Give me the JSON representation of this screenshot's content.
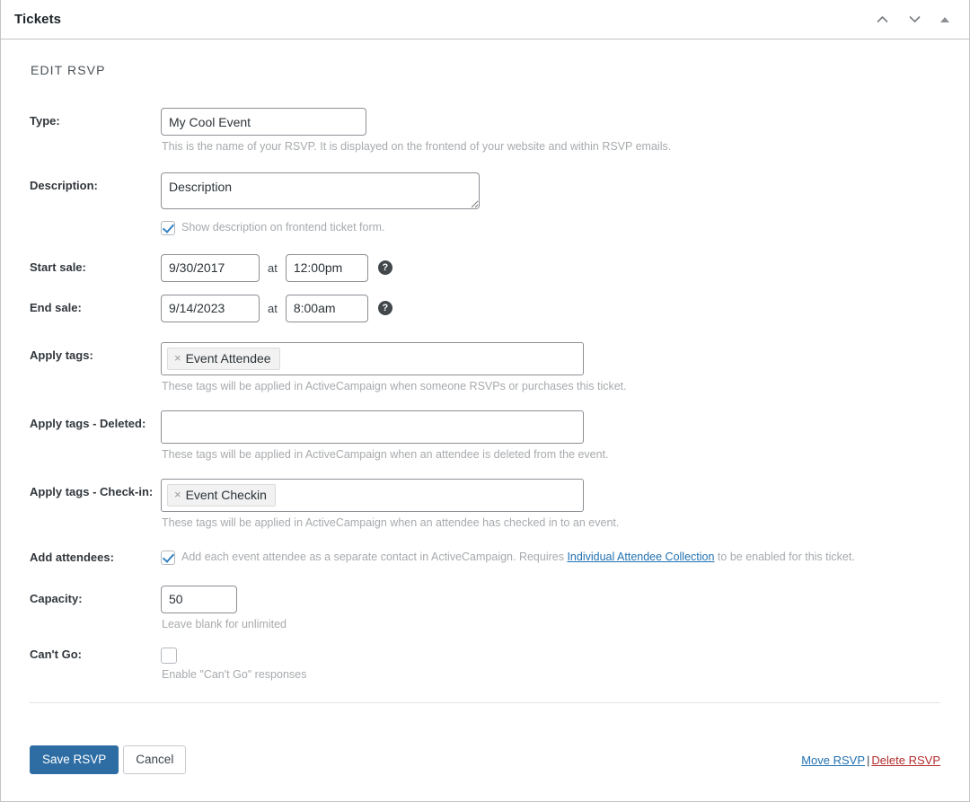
{
  "panel": {
    "title": "Tickets",
    "header_actions": [
      {
        "name": "move-up",
        "icon": "chevron-up-icon"
      },
      {
        "name": "move-down",
        "icon": "chevron-down-icon"
      },
      {
        "name": "collapse",
        "icon": "triangle-up-icon"
      }
    ]
  },
  "section": {
    "title": "EDIT RSVP"
  },
  "fields": {
    "type": {
      "label": "Type:",
      "value": "My Cool Event",
      "hint": "This is the name of your RSVP. It is displayed on the frontend of your website and within RSVP emails."
    },
    "description": {
      "label": "Description:",
      "value": "Description",
      "checkbox_label": "Show description on frontend ticket form.",
      "checked": true
    },
    "start_sale": {
      "label": "Start sale:",
      "date": "9/30/2017",
      "at": "at",
      "time": "12:00pm",
      "help": "?"
    },
    "end_sale": {
      "label": "End sale:",
      "date": "9/14/2023",
      "at": "at",
      "time": "8:00am",
      "help": "?"
    },
    "apply_tags": {
      "label": "Apply tags:",
      "tag": "Event Attendee",
      "remove": "×",
      "hint": "These tags will be applied in ActiveCampaign when someone RSVPs or purchases this ticket."
    },
    "apply_tags_deleted": {
      "label": "Apply tags - Deleted:",
      "tag": "",
      "hint": "These tags will be applied in ActiveCampaign when an attendee is deleted from the event."
    },
    "apply_tags_checkin": {
      "label": "Apply tags - Check-in:",
      "tag": "Event Checkin",
      "remove": "×",
      "hint": "These tags will be applied in ActiveCampaign when an attendee has checked in to an event."
    },
    "add_attendees": {
      "label": "Add attendees:",
      "checked": true,
      "text_before": "Add each event attendee as a separate contact in ActiveCampaign. Requires ",
      "link": "Individual Attendee Collection",
      "text_after": " to be enabled for this ticket."
    },
    "capacity": {
      "label": "Capacity:",
      "value": "50",
      "hint": "Leave blank for unlimited"
    },
    "cant_go": {
      "label": "Can't Go:",
      "checked": false,
      "text": "Enable \"Can't Go\" responses"
    }
  },
  "footer": {
    "save_label": "Save RSVP",
    "cancel_label": "Cancel",
    "move_label": "Move RSVP",
    "separator": "|",
    "delete_label": "Delete RSVP"
  },
  "colors": {
    "primary": "#2e6da4",
    "link": "#2271b1",
    "danger": "#b32d2e",
    "checkmark": "#3582c4"
  }
}
